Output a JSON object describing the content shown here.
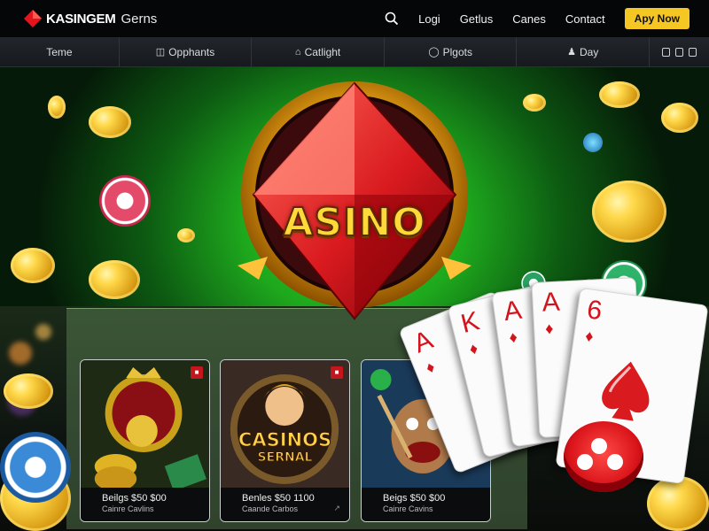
{
  "header": {
    "brand_name": "KASINGEM",
    "brand_sub": "Gerns",
    "nav": [
      "Logi",
      "Getlus",
      "Canes",
      "Contact"
    ],
    "cta_label": "Apy Now"
  },
  "subnav": {
    "items": [
      {
        "label": "Teme",
        "icon": ""
      },
      {
        "label": "Opphants",
        "icon": "gift-icon"
      },
      {
        "label": "Catlight",
        "icon": "home-icon"
      },
      {
        "label": "Plgots",
        "icon": "shield-icon"
      },
      {
        "label": "Day",
        "icon": "user-icon"
      }
    ]
  },
  "hero": {
    "logo_text": "ASINO",
    "playing_cards": [
      "A",
      "K",
      "A",
      "A",
      "6"
    ]
  },
  "cards": [
    {
      "cap1": "Beilgs $50 $00",
      "cap2": "Cainre Cavlins",
      "badge": ""
    },
    {
      "cap1": "Benles $50 1100",
      "cap2": "Caande Carbos",
      "badge": "",
      "logo_line1": "CASINOS",
      "logo_line2": "SERNAL"
    },
    {
      "cap1": "Beigs $50 $00",
      "cap2": "Cainre Cavins",
      "badge": ""
    }
  ],
  "colors": {
    "cta": "#f6c623",
    "hero_green": "#2bc21f",
    "emblem_red": "#d91a1f",
    "gold": "#ffd83a"
  }
}
